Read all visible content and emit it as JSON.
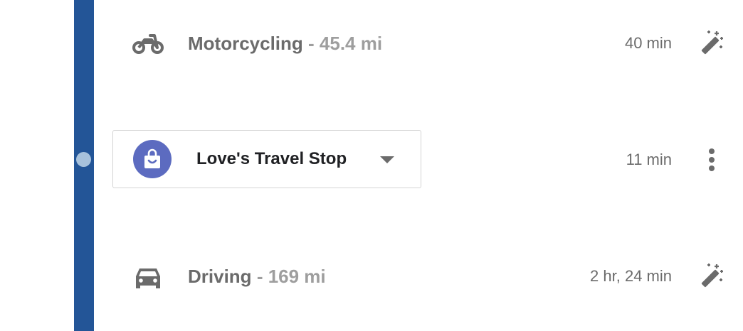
{
  "rows": {
    "motorcycle": {
      "mode": "Motorcycling",
      "distance": "- 45.4 mi",
      "duration": "40 min",
      "icon": "motorcycle-icon",
      "action_icon": "magic-wand-icon"
    },
    "stop": {
      "name": "Love's Travel Stop",
      "duration": "11 min",
      "icon": "shopping-bag-icon",
      "menu_icon": "more-vert-icon"
    },
    "driving": {
      "mode": "Driving",
      "distance": "- 169 mi",
      "duration": "2 hr, 24 min",
      "icon": "car-icon",
      "action_icon": "magic-wand-icon"
    }
  },
  "colors": {
    "route_line": "#235597",
    "stop_dot": "#a8c2dc",
    "stop_avatar": "#5c6bc0",
    "text_primary": "#202124",
    "text_secondary": "#6b6b6b",
    "text_muted": "#9e9e9e"
  }
}
